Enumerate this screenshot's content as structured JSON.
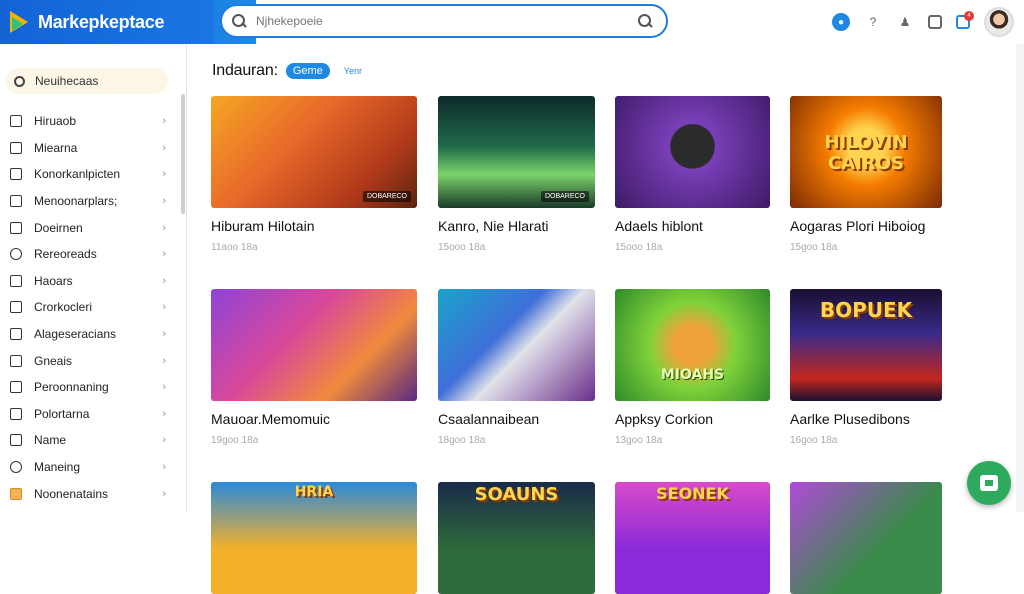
{
  "brand": {
    "name": "Markepkeptace"
  },
  "search": {
    "placeholder": "Njhekepoeie"
  },
  "sidebar": {
    "search_label": "Neuihecaas",
    "items": [
      {
        "label": "Hiruaob"
      },
      {
        "label": "Miearna"
      },
      {
        "label": "Konorkanlpicten"
      },
      {
        "label": "Menoonarplars;"
      },
      {
        "label": "Doeirnen"
      },
      {
        "label": "Rereoreads"
      },
      {
        "label": "Haoars"
      },
      {
        "label": "Crorkocleri"
      },
      {
        "label": "Alageseracians"
      },
      {
        "label": "Gneais"
      },
      {
        "label": "Peroonnaning"
      },
      {
        "label": "Polortarna"
      },
      {
        "label": "Name"
      },
      {
        "label": "Maneing"
      },
      {
        "label": "Noonenatains"
      }
    ]
  },
  "section": {
    "title": "Indauran:",
    "chip": "Geme",
    "link": "Yenr"
  },
  "cards": [
    {
      "title": "Hiburam Hilotain",
      "meta": "11aoo 18a",
      "tag": "DOBARECO",
      "banner": ""
    },
    {
      "title": "Kanro, Nie Hlarati",
      "meta": "15ooo 18a",
      "tag": "DOBARECO",
      "banner": ""
    },
    {
      "title": "Adaels hiblont",
      "meta": "15ooo 18a",
      "tag": "",
      "banner": ""
    },
    {
      "title": "Aogaras Plori Hiboiog",
      "meta": "15goo 18a",
      "tag": "",
      "banner": "HILOVIN CAIROS"
    },
    {
      "title": "Mauoar.Memomuic",
      "meta": "19goo 18a",
      "tag": "",
      "banner": ""
    },
    {
      "title": "Csaalannaibean",
      "meta": "18goo 18a",
      "tag": "",
      "banner": ""
    },
    {
      "title": "Appksy Corkion",
      "meta": "13goo 18a",
      "tag": "",
      "banner": "MIOAHS"
    },
    {
      "title": "Aarlke Plusedibons",
      "meta": "16goo 18a",
      "tag": "",
      "banner": "BOPUEK"
    },
    {
      "title": "",
      "meta": "",
      "tag": "",
      "banner": "HRIA"
    },
    {
      "title": "",
      "meta": "",
      "tag": "",
      "banner": "SOAUNS"
    },
    {
      "title": "",
      "meta": "",
      "tag": "",
      "banner": "SEONEK"
    },
    {
      "title": "",
      "meta": "",
      "tag": "",
      "banner": ""
    }
  ],
  "colors": {
    "accent": "#1e88e5",
    "brand_bar": "#1565d8",
    "fab": "#2eaa5f"
  },
  "icons": {
    "fab": "chat-icon",
    "notification_badge": "4"
  }
}
